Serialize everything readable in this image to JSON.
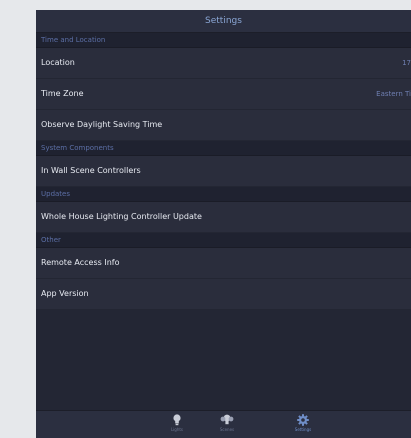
{
  "header": {
    "title": "Settings"
  },
  "sections": [
    {
      "header": "Time and Location",
      "rows": [
        {
          "label": "Location",
          "value": "17"
        },
        {
          "label": "Time Zone",
          "value": "Eastern Ti"
        },
        {
          "label": "Observe Daylight Saving Time"
        }
      ]
    },
    {
      "header": "System Components",
      "rows": [
        {
          "label": "In Wall Scene Controllers"
        }
      ]
    },
    {
      "header": "Updates",
      "rows": [
        {
          "label": "Whole House Lighting Controller Update"
        }
      ]
    },
    {
      "header": "Other",
      "rows": [
        {
          "label": "Remote Access Info"
        },
        {
          "label": "App Version"
        }
      ]
    }
  ],
  "tabbar": {
    "tabs": [
      {
        "label": "Lights",
        "icon": "lightbulb-icon"
      },
      {
        "label": "Scenes",
        "icon": "scenes-icon"
      },
      {
        "label": "Settings",
        "icon": "gear-icon",
        "active": true
      }
    ]
  },
  "colors": {
    "background": "#232634",
    "row": "#2a2d3c",
    "section_header_text": "#5c6fa6",
    "accent": "#6f8ec8"
  }
}
